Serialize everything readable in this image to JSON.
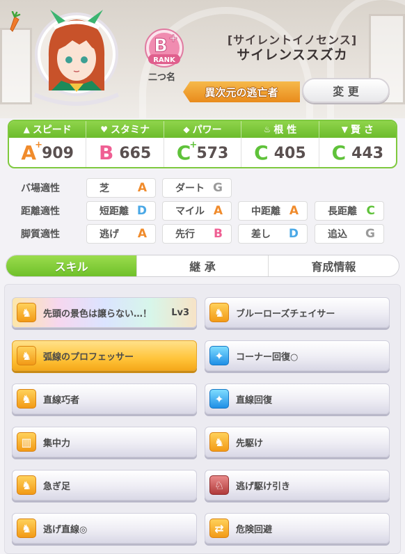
{
  "header": {
    "rank_letter": "B+",
    "rank_word": "RANK",
    "nickname_label": "二つ名",
    "outfit_name": "[サイレントイノセンス]",
    "character_name": "サイレンススズカ",
    "title_value": "異次元の逃亡者",
    "change_button": "変 更"
  },
  "stats": [
    {
      "label": "スピード",
      "icon": "shoe-icon",
      "grade": "A",
      "plus": "+",
      "value": "909",
      "color": "#f08b2c"
    },
    {
      "label": "スタミナ",
      "icon": "heart-icon",
      "grade": "B",
      "plus": "",
      "value": "665",
      "color": "#ef5f93"
    },
    {
      "label": "パワー",
      "icon": "muscle-icon",
      "grade": "C",
      "plus": "+",
      "value": "573",
      "color": "#5fc23a"
    },
    {
      "label": "根 性",
      "icon": "flame-icon",
      "grade": "C",
      "plus": "",
      "value": "405",
      "color": "#5fc23a"
    },
    {
      "label": "賢 さ",
      "icon": "graduation-cap-icon",
      "grade": "C",
      "plus": "",
      "value": "443",
      "color": "#5fc23a"
    }
  ],
  "aptitudes": {
    "track": {
      "label": "バ場適性",
      "items": [
        {
          "name": "芝",
          "grade": "A",
          "color": "#f08b2c"
        },
        {
          "name": "ダート",
          "grade": "G",
          "color": "#9a9a9a"
        }
      ]
    },
    "distance": {
      "label": "距離適性",
      "items": [
        {
          "name": "短距離",
          "grade": "D",
          "color": "#4aa8e6"
        },
        {
          "name": "マイル",
          "grade": "A",
          "color": "#f08b2c"
        },
        {
          "name": "中距離",
          "grade": "A",
          "color": "#f08b2c"
        },
        {
          "name": "長距離",
          "grade": "C",
          "color": "#5fc23a"
        }
      ]
    },
    "style": {
      "label": "脚質適性",
      "items": [
        {
          "name": "逃げ",
          "grade": "A",
          "color": "#f08b2c"
        },
        {
          "name": "先行",
          "grade": "B",
          "color": "#ef5f93"
        },
        {
          "name": "差し",
          "grade": "D",
          "color": "#4aa8e6"
        },
        {
          "name": "追込",
          "grade": "G",
          "color": "#9a9a9a"
        }
      ]
    }
  },
  "tabs": [
    {
      "label": "スキル",
      "active": true
    },
    {
      "label": "継 承",
      "active": false
    },
    {
      "label": "育成情報",
      "active": false
    }
  ],
  "skills": [
    {
      "name": "先頭の景色は譲らない…！",
      "level": "Lv3",
      "icon": "running-horse-icon",
      "style": "rainbow",
      "iconColor": "orange"
    },
    {
      "name": "ブルーローズチェイサー",
      "level": "",
      "icon": "running-horse-icon",
      "style": "normal",
      "iconColor": "orange"
    },
    {
      "name": "弧線のプロフェッサー",
      "level": "",
      "icon": "running-horse-icon",
      "style": "gold",
      "iconColor": "orange"
    },
    {
      "name": "コーナー回復○",
      "level": "",
      "icon": "sparkle-icon",
      "style": "normal",
      "iconColor": "blue"
    },
    {
      "name": "直線巧者",
      "level": "",
      "icon": "running-horse-icon",
      "style": "normal",
      "iconColor": "orange"
    },
    {
      "name": "直線回復",
      "level": "",
      "icon": "sparkle-icon",
      "style": "normal",
      "iconColor": "blue"
    },
    {
      "name": "集中力",
      "level": "",
      "icon": "gate-icon",
      "style": "normal",
      "iconColor": "orange"
    },
    {
      "name": "先駆け",
      "level": "",
      "icon": "running-horse-icon",
      "style": "normal",
      "iconColor": "orange"
    },
    {
      "name": "急ぎ足",
      "level": "",
      "icon": "running-horse-icon",
      "style": "normal",
      "iconColor": "orange"
    },
    {
      "name": "逃げ駆け引き",
      "level": "",
      "icon": "horse-head-icon",
      "style": "normal",
      "iconColor": "red"
    },
    {
      "name": "逃げ直線◎",
      "level": "",
      "icon": "running-horse-icon",
      "style": "normal",
      "iconColor": "orange"
    },
    {
      "name": "危険回避",
      "level": "",
      "icon": "swap-arrows-icon",
      "style": "normal",
      "iconColor": "orange"
    }
  ]
}
